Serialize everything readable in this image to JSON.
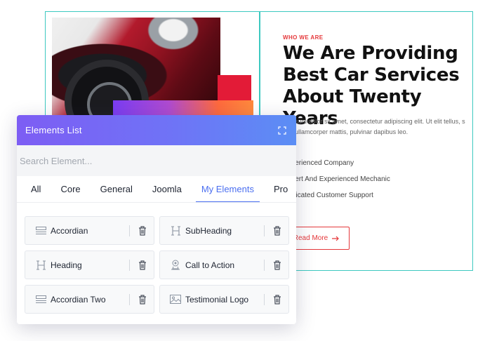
{
  "site": {
    "eyebrow": "WHO WE ARE",
    "headline": "We Are Providing Best Car Services About Twenty Years",
    "paragraph": "m ipsum dolor sit amet, consectetur adipiscing elit. Ut elit tellus, s nec ullamcorper mattis, pulvinar dapibus leo.",
    "features": [
      "Experienced Company",
      "Expert And Experienced Mechanic",
      "Dedicated Customer Support"
    ],
    "read_more": "Read More",
    "read_more_icon": "arrow-right-icon",
    "colors": {
      "accent": "#e5383b",
      "frame": "#3dc9c0"
    }
  },
  "panel": {
    "title": "Elements List",
    "expand_icon": "expand-icon",
    "search_placeholder": "Search Element...",
    "tabs": [
      {
        "label": "All",
        "active": false
      },
      {
        "label": "Core",
        "active": false
      },
      {
        "label": "General",
        "active": false
      },
      {
        "label": "Joomla",
        "active": false
      },
      {
        "label": "My Elements",
        "active": true
      },
      {
        "label": "Pro",
        "active": false
      }
    ],
    "elements": [
      {
        "label": "Accordian",
        "icon": "accordion-icon"
      },
      {
        "label": "SubHeading",
        "icon": "heading-icon"
      },
      {
        "label": "Heading",
        "icon": "heading-icon"
      },
      {
        "label": "Call to Action",
        "icon": "call-to-action-icon"
      },
      {
        "label": "Accordian Two",
        "icon": "accordion-icon"
      },
      {
        "label": "Testimonial Logo",
        "icon": "image-icon"
      }
    ],
    "delete_icon": "trash-icon",
    "colors": {
      "header_start": "#7d5df4",
      "header_end": "#5b8ef5",
      "active_tab": "#4b6ff0"
    }
  }
}
